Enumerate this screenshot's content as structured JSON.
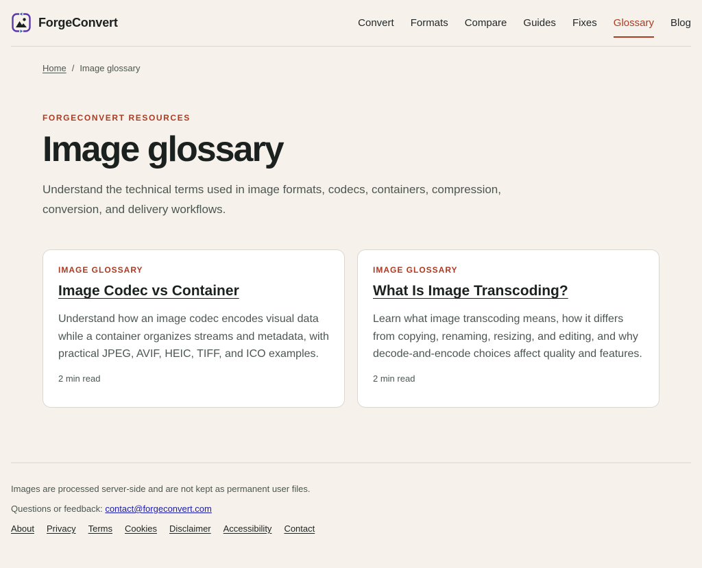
{
  "brand": {
    "name": "ForgeConvert",
    "logo_icon": "image-convert-icon",
    "logo_colors": [
      "#5b3aa8",
      "#2f6fb0"
    ]
  },
  "nav": {
    "items": [
      {
        "label": "Convert",
        "active": false
      },
      {
        "label": "Formats",
        "active": false
      },
      {
        "label": "Compare",
        "active": false
      },
      {
        "label": "Guides",
        "active": false
      },
      {
        "label": "Fixes",
        "active": false
      },
      {
        "label": "Glossary",
        "active": true
      },
      {
        "label": "Blog",
        "active": false
      }
    ]
  },
  "breadcrumb": {
    "home": "Home",
    "separator": "/",
    "current": "Image glossary"
  },
  "hero": {
    "eyebrow": "FORGECONVERT RESOURCES",
    "title": "Image glossary",
    "lede": "Understand the technical terms used in image formats, codecs, containers, compression, conversion, and delivery workflows."
  },
  "cards": [
    {
      "kicker": "IMAGE GLOSSARY",
      "title": "Image Codec vs Container",
      "description": "Understand how an image codec encodes visual data while a container organizes streams and metadata, with practical JPEG, AVIF, HEIC, TIFF, and ICO examples.",
      "meta": "2 min read"
    },
    {
      "kicker": "IMAGE GLOSSARY",
      "title": "What Is Image Transcoding?",
      "description": "Learn what image transcoding means, how it differs from copying, renaming, resizing, and editing, and why decode-and-encode choices affect quality and features.",
      "meta": "2 min read"
    }
  ],
  "footer": {
    "note": "Images are processed server-side and are not kept as permanent user files.",
    "contact_prefix": "Questions or feedback:",
    "contact_email": "contact@forgeconvert.com",
    "links": [
      "About",
      "Privacy",
      "Terms",
      "Cookies",
      "Disclaimer",
      "Accessibility",
      "Contact"
    ]
  },
  "colors": {
    "accent": "#ad3a22",
    "background": "#f6f2eb",
    "text": "#1b211f",
    "muted": "#4c5651"
  }
}
